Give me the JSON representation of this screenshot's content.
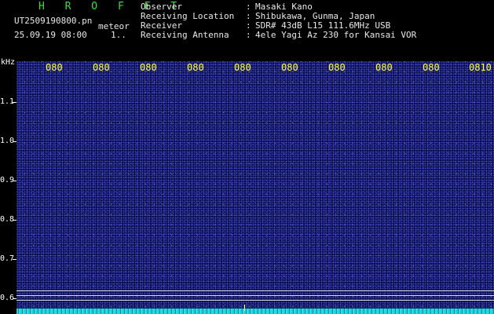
{
  "header": {
    "app_name": "H R O F F T",
    "filename": "UT2509190800.pn",
    "tag": "meteor",
    "datetime": "25.09.19 08:00",
    "count": "1..",
    "observer_key": "Observer",
    "observer_val": "Masaki Kano",
    "location_key": "Receiving Location",
    "location_val": "Shibukawa, Gunma, Japan",
    "receiver_key": "Receiver",
    "receiver_val": "SDR# 43dB L15 111.6MHz USB",
    "antenna_key": "Receiving Antenna",
    "antenna_val": "4ele Yagi Az 230 for Kansai VOR",
    "sep": ":"
  },
  "axis": {
    "unit": "kHz",
    "y_labels": [
      "1.1",
      "1.0",
      "0.9",
      "0.8",
      "0.7",
      "0.6"
    ],
    "x_labels": [
      "080",
      "080",
      "080",
      "080",
      "080",
      "080",
      "080",
      "080",
      "080",
      "0810"
    ]
  },
  "colors": {
    "header_green": "#3ddc3d",
    "header_text": "#e8e8e8",
    "time_labels": "#ffff44",
    "background": "#0a0c4a",
    "baseline": "#18d0d8"
  }
}
